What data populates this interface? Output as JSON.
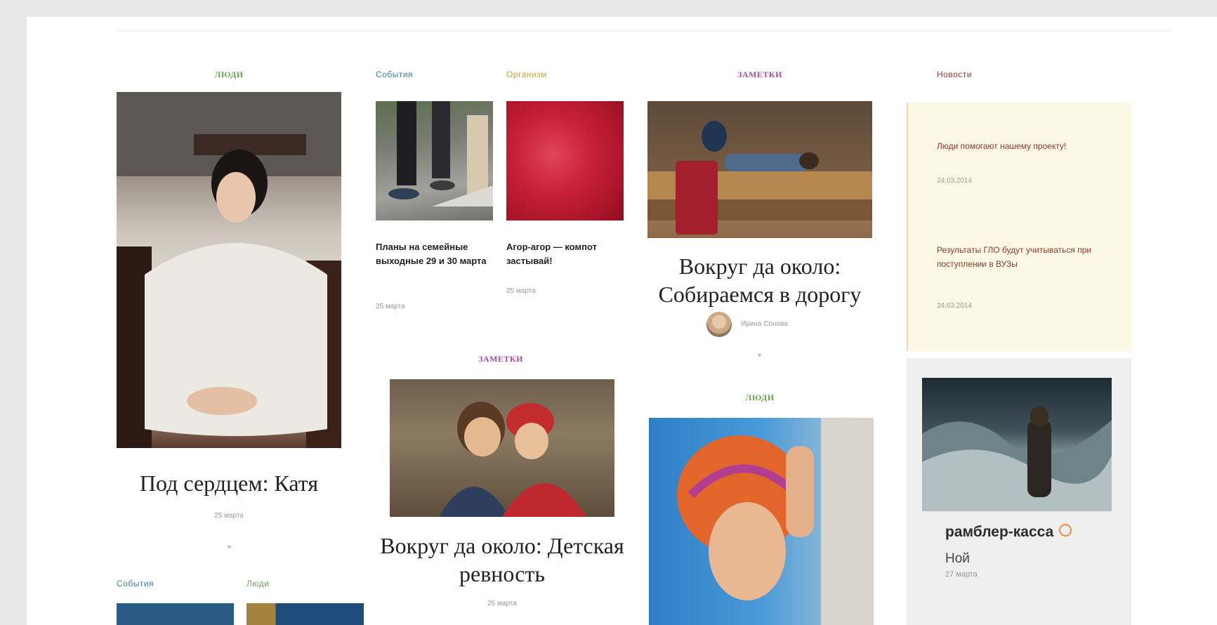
{
  "col1": {
    "category": "ЛЮДИ",
    "title": "Под сердцем: Катя",
    "date": "25 марта"
  },
  "col2a": {
    "category": "События",
    "title": "Планы на семейные выходные 29 и 30 марта",
    "date": "25 марта"
  },
  "col2b": {
    "category": "Организм",
    "title": "Агор-агор — компот застывай!",
    "date": "25 марта"
  },
  "col2c": {
    "category": "ЗАМЕТКИ",
    "title": "Вокруг да около: Детская ревность",
    "date": "25 марта"
  },
  "col3a": {
    "category": "ЗАМЕТКИ",
    "title": "Вокруг да около: Собираемся в дорогу",
    "author": "Ирина Сонова"
  },
  "col3b": {
    "category": "ЛЮДИ"
  },
  "bottom_left": {
    "cat1": "События",
    "cat2": "Люди"
  },
  "news": {
    "header": "Новости",
    "items": [
      {
        "title": "Люди помогают нашему проекту!",
        "date": "24.03.2014"
      },
      {
        "title": "Результаты ГЛО будут учитываться при поступлении в ВУЗы",
        "date": "24.03.2014"
      }
    ]
  },
  "rambler": {
    "brand": "рамблер-касса",
    "movie": "Ной",
    "date": "27 марта"
  },
  "colors": {
    "people": "#6aa84f",
    "events": "#3d7ea6",
    "organism": "#c8a43a",
    "notes": "#a64ca6",
    "news": "#8b3a2b"
  }
}
